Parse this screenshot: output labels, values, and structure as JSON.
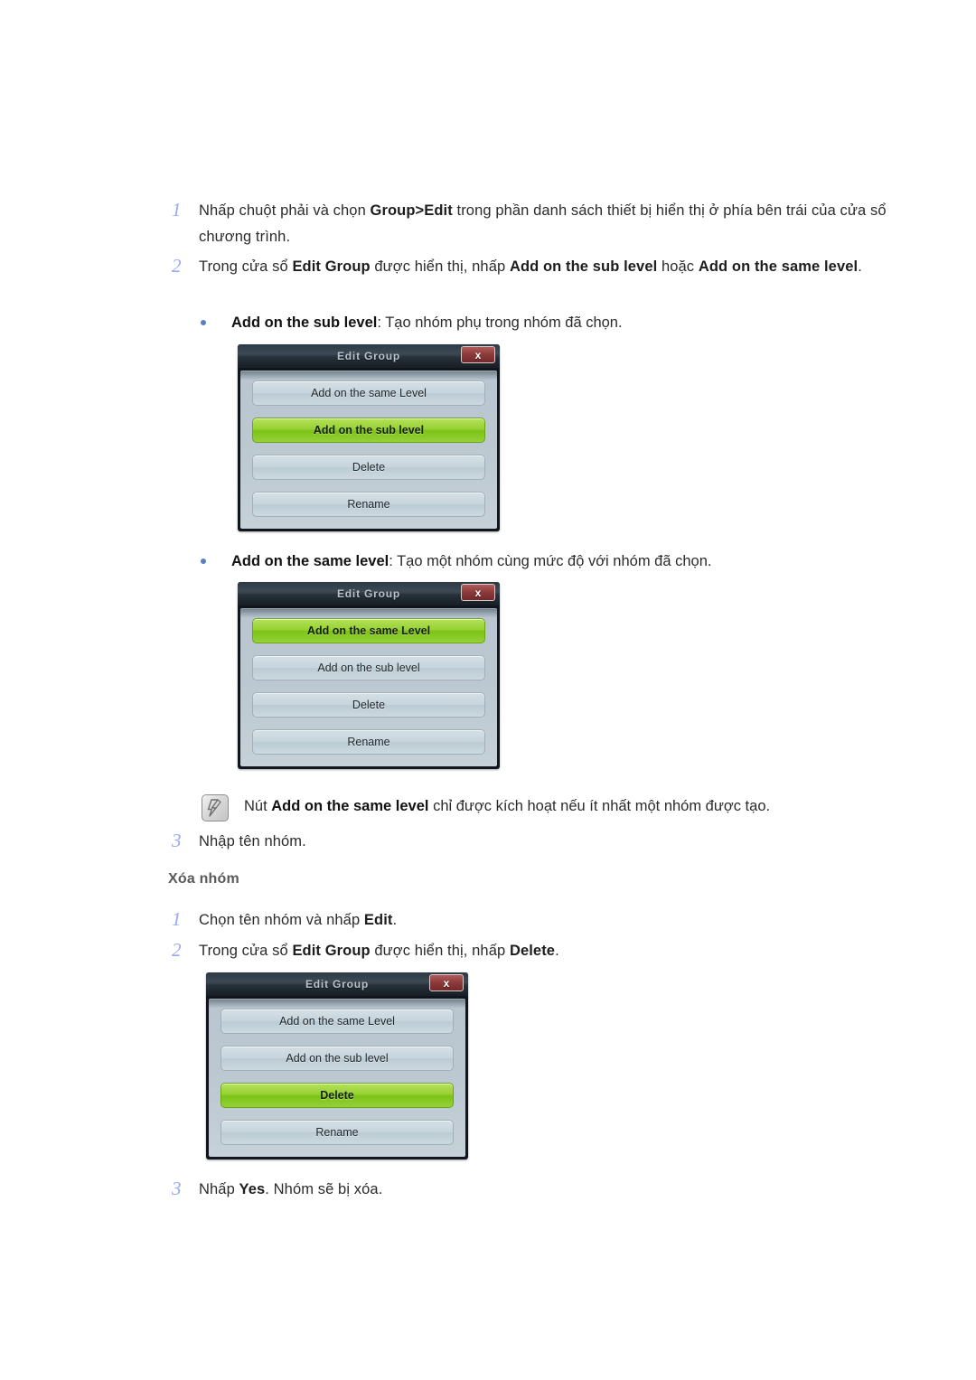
{
  "document": {
    "language": "vi",
    "accent_step_number": "#9aa8ee",
    "accent_bullet": "#5a7ec0",
    "heading_color": "#595959",
    "selected_button_color": "#8fcc2c"
  },
  "steps_group1": [
    {
      "number": "1",
      "parts": [
        {
          "t": "Nhấp chuột phải và chọn ",
          "b": false
        },
        {
          "t": "Group>Edit",
          "b": true
        },
        {
          "t": " trong phần danh sách thiết bị hiển thị ở phía bên trái của cửa sổ chương trình.",
          "b": false
        }
      ]
    },
    {
      "number": "2",
      "parts": [
        {
          "t": "Trong cửa sổ ",
          "b": false
        },
        {
          "t": "Edit Group",
          "b": true
        },
        {
          "t": " được hiển thị, nhấp ",
          "b": false
        },
        {
          "t": "Add on the sub level",
          "b": true
        },
        {
          "t": " hoặc ",
          "b": false
        },
        {
          "t": "Add on the same level",
          "b": true
        },
        {
          "t": ".",
          "b": false
        }
      ]
    }
  ],
  "bullet_sub_level": {
    "parts": [
      {
        "t": "Add on the sub level",
        "b": true
      },
      {
        "t": ": Tạo nhóm phụ trong nhóm đã chọn.",
        "b": false
      }
    ]
  },
  "bullet_same_level": {
    "parts": [
      {
        "t": "Add on the same level",
        "b": true
      },
      {
        "t": ": Tạo một nhóm cùng mức độ với nhóm đã chọn.",
        "b": false
      }
    ]
  },
  "note": {
    "icon": "note-pencil-icon",
    "parts": [
      {
        "t": "Nút ",
        "b": false
      },
      {
        "t": "Add on the same level",
        "b": true
      },
      {
        "t": " chỉ được kích hoạt nếu ít nhất một nhóm được tạo.",
        "b": false
      }
    ]
  },
  "step3_group1": {
    "number": "3",
    "parts": [
      {
        "t": "Nhập tên nhóm.",
        "b": false
      }
    ]
  },
  "section_heading": "Xóa nhóm",
  "steps_group2": [
    {
      "number": "1",
      "parts": [
        {
          "t": "Chọn tên nhóm và nhấp ",
          "b": false
        },
        {
          "t": "Edit",
          "b": true
        },
        {
          "t": ".",
          "b": false
        }
      ]
    },
    {
      "number": "2",
      "parts": [
        {
          "t": "Trong cửa sổ ",
          "b": false
        },
        {
          "t": "Edit Group",
          "b": true
        },
        {
          "t": " được hiển thị, nhấp ",
          "b": false
        },
        {
          "t": "Delete",
          "b": true
        },
        {
          "t": ".",
          "b": false
        }
      ]
    }
  ],
  "step3_group2": {
    "number": "3",
    "parts": [
      {
        "t": "Nhấp ",
        "b": false
      },
      {
        "t": "Yes",
        "b": true
      },
      {
        "t": ". Nhóm sẽ bị xóa.",
        "b": false
      }
    ]
  },
  "dialogs": [
    {
      "id": "dialog-sub-level",
      "title": "Edit Group",
      "close_label": "x",
      "buttons": [
        {
          "label": "Add on the same Level",
          "selected": false
        },
        {
          "label": "Add on the sub level",
          "selected": true
        },
        {
          "label": "Delete",
          "selected": false
        },
        {
          "label": "Rename",
          "selected": false
        }
      ]
    },
    {
      "id": "dialog-same-level",
      "title": "Edit Group",
      "close_label": "x",
      "buttons": [
        {
          "label": "Add on the same Level",
          "selected": true
        },
        {
          "label": "Add on the sub level",
          "selected": false
        },
        {
          "label": "Delete",
          "selected": false
        },
        {
          "label": "Rename",
          "selected": false
        }
      ]
    },
    {
      "id": "dialog-delete",
      "title": "Edit Group",
      "close_label": "x",
      "buttons": [
        {
          "label": "Add on the same Level",
          "selected": false
        },
        {
          "label": "Add on the sub level",
          "selected": false
        },
        {
          "label": "Delete",
          "selected": true
        },
        {
          "label": "Rename",
          "selected": false
        }
      ]
    }
  ]
}
